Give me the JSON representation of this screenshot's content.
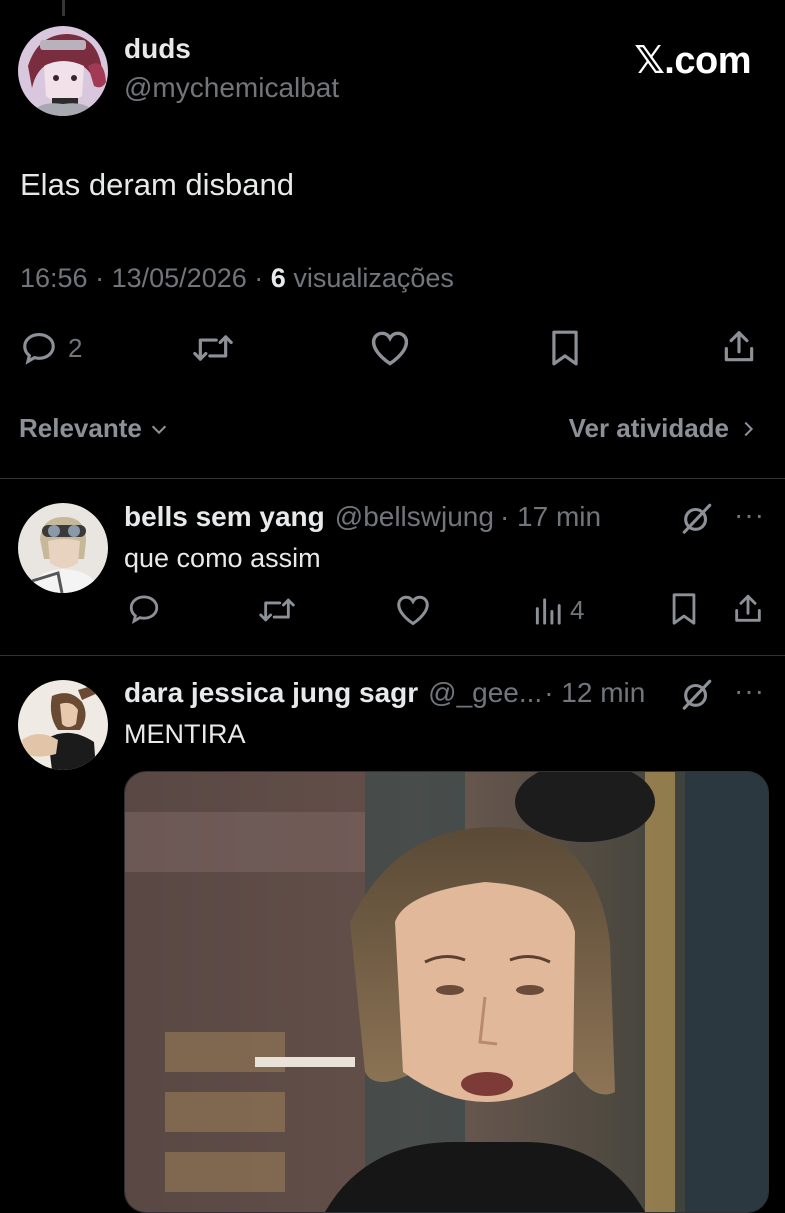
{
  "brand": {
    "watermark": "𝕏.com"
  },
  "tweet": {
    "display_name": "duds",
    "handle": "@mychemicalbat",
    "text": "Elas deram disband",
    "time": "16:56",
    "date": "13/05/2026",
    "separator": "·",
    "views_count": "6",
    "views_label": "visualizações",
    "replies": "2",
    "avatar_icon": "anime-avatar"
  },
  "sort": {
    "label": "Relevante",
    "activity_label": "Ver atividade"
  },
  "replies": [
    {
      "display_name": "bells sem yang",
      "handle": "@bellswjung",
      "time": "· 17 min",
      "text": "que como assim",
      "views": "4",
      "more": "···"
    },
    {
      "display_name": "dara jessica jung sagr",
      "handle": "@_gee...",
      "time": "· 12 min",
      "text": "MENTIRA",
      "more": "···"
    }
  ],
  "colors": {
    "background": "#000000",
    "text": "#e7e9ea",
    "muted": "#71767b",
    "divider": "#2f3336"
  }
}
